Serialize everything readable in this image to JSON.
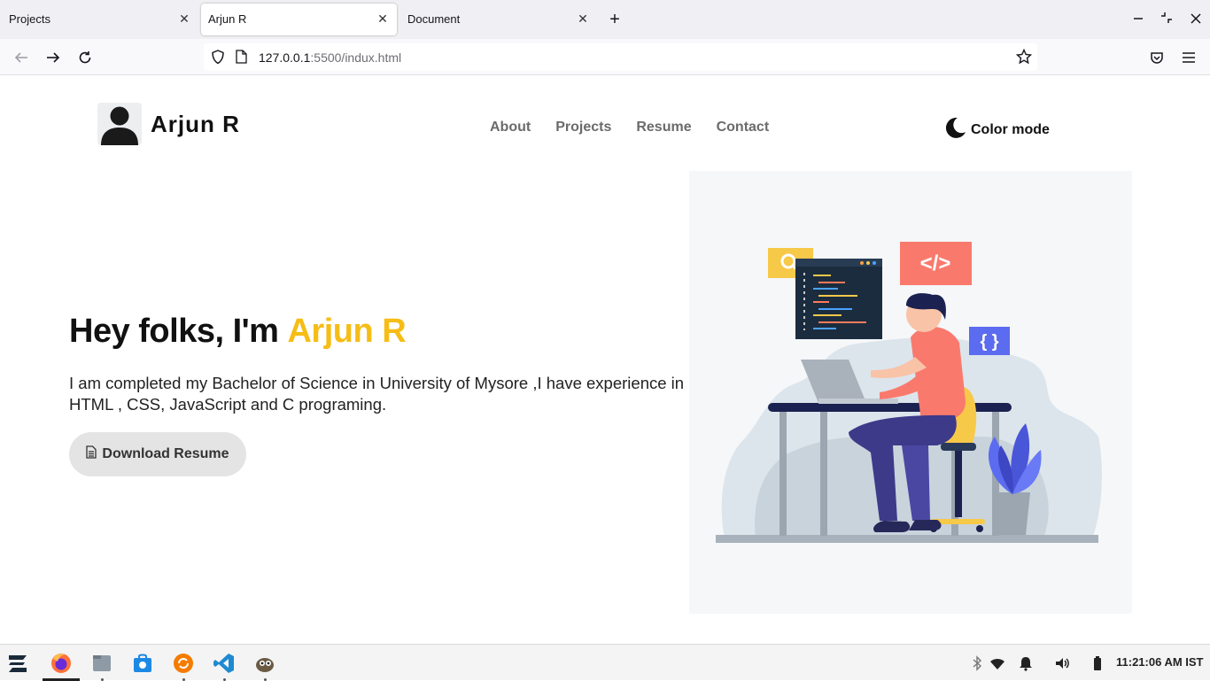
{
  "browser": {
    "tabs": [
      {
        "label": "Projects",
        "active": false
      },
      {
        "label": "Arjun R",
        "active": true
      },
      {
        "label": "Document",
        "active": false
      }
    ],
    "url_host": "127.0.0.1",
    "url_rest": ":5500/indux.html"
  },
  "site": {
    "logo_name": "Arjun R",
    "nav": [
      "About",
      "Projects",
      "Resume",
      "Contact"
    ],
    "color_mode_label": "Color mode",
    "hero_prefix": "Hey folks, I'm",
    "hero_name": "Arjun R",
    "hero_desc": "I am completed my Bachelor of Science in University of Mysore ,I have experience in HTML , CSS, JavaScript and C programing.",
    "download_label": "Download Resume",
    "accent_color": "#f6bd16",
    "code_tag": "</>",
    "braces": "{ }"
  },
  "taskbar": {
    "apps": [
      "zorin-menu-icon",
      "firefox-icon",
      "files-icon",
      "software-store-icon",
      "update-icon",
      "vscode-icon",
      "gimp-icon"
    ],
    "clock": "11:21:06 AM IST"
  }
}
